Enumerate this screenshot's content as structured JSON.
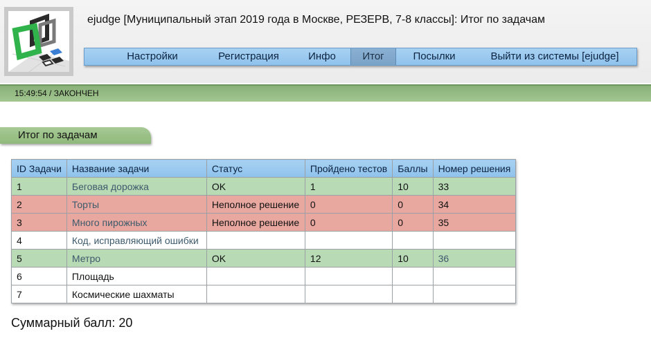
{
  "header": {
    "title": "ejudge [Муниципальный этап 2019 года в Москве, РЕЗЕРВ, 7-8 классы]: Итог по задачам",
    "logo_icon": "ejudge-logo-icon"
  },
  "menu": {
    "items": [
      {
        "label": "Настройки"
      },
      {
        "label": "Регистрация"
      },
      {
        "label": "Инфо"
      },
      {
        "label": "Итог"
      },
      {
        "label": "Посылки"
      },
      {
        "label": "Выйти из системы [ejudge]"
      }
    ],
    "active": "Итог"
  },
  "status_bar": {
    "text": "15:49:54 / ЗАКОНЧЕН"
  },
  "section": {
    "title": "Итог по задачам"
  },
  "table": {
    "headers": [
      "ID Задачи",
      "Название задачи",
      "Статус",
      "Пройдено тестов",
      "Баллы",
      "Номер решения"
    ],
    "rows": [
      {
        "id": "1",
        "name": "Беговая дорожка",
        "status": "OK",
        "tests": "1",
        "score": "10",
        "run": "33"
      },
      {
        "id": "2",
        "name": "Торты",
        "status": "Неполное решение",
        "tests": "0",
        "score": "0",
        "run": "34"
      },
      {
        "id": "3",
        "name": "Много пирожных",
        "status": "Неполное решение",
        "tests": "0",
        "score": "0",
        "run": "35"
      },
      {
        "id": "4",
        "name": "Код, исправляющий ошибки",
        "status": "",
        "tests": "",
        "score": "",
        "run": ""
      },
      {
        "id": "5",
        "name": "Метро",
        "status": "OK",
        "tests": "12",
        "score": "10",
        "run": "36"
      },
      {
        "id": "6",
        "name": "Площадь",
        "status": "",
        "tests": "",
        "score": "",
        "run": ""
      },
      {
        "id": "7",
        "name": "Космические шахматы",
        "status": "",
        "tests": "",
        "score": "",
        "run": ""
      }
    ]
  },
  "total": {
    "text": "Суммарный балл: 20"
  },
  "colors": {
    "menu_bg": "#8fc2ec",
    "status_bar_bg": "#88b178",
    "row_ok": "#b8dab5",
    "row_partial": "#e8a8a0",
    "link": "#3d5a6c"
  }
}
